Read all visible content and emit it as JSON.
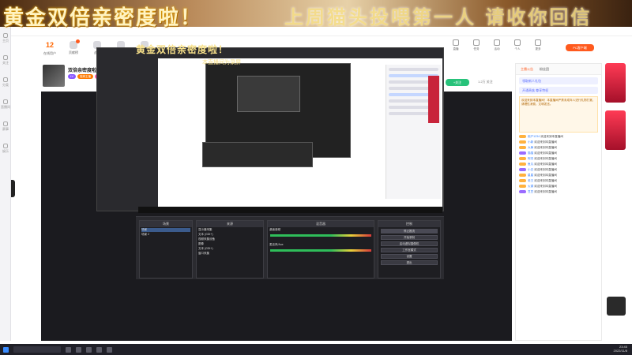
{
  "banner": {
    "left_text": "黄金双倍亲密度啦！",
    "right_text": "上周猫头投喂第一人  请收你回信"
  },
  "rail": {
    "items": [
      "主页",
      "关注",
      "分类",
      "直播间",
      "赛事",
      "娱乐"
    ]
  },
  "nav": {
    "count_value": "12",
    "items": [
      {
        "label": "在线用户",
        "icon": "users-icon",
        "num": true
      },
      {
        "label": "贡献榜",
        "icon": "trophy-icon",
        "dot": true
      },
      {
        "label": "战队",
        "icon": "team-icon"
      },
      {
        "label": "礼物",
        "icon": "gift-icon"
      },
      {
        "label": "分享",
        "icon": "share-icon"
      }
    ]
  },
  "room": {
    "title": "双倍亲密度啦！！！",
    "pills": [
      "LV",
      "猫窝主播",
      "黄金双倍",
      "亲密度"
    ]
  },
  "video": {
    "overlay_title": "黄金双倍亲密度啦！",
    "overlay_sub": "本直播间为录屏"
  },
  "obs": {
    "scenes_head": "场景",
    "sources_head": "来源",
    "mixer_head": "混音器",
    "controls_head": "控制",
    "scenes": [
      "场景",
      "场景 2"
    ],
    "sources": [
      "显示器采集",
      "文本 (GDI+)",
      "视频采集设备",
      "图像",
      "文本 (GDI+)",
      "窗口采集"
    ],
    "mixer_tracks": [
      "桌面音频",
      "麦克风/Aux"
    ],
    "controls": [
      "停止推流",
      "开始录制",
      "启动虚拟摄像机",
      "工作室模式",
      "设置",
      "退出"
    ]
  },
  "right": {
    "icons": [
      {
        "label": "直播",
        "icon": "live-icon"
      },
      {
        "label": "任务",
        "icon": "task-icon"
      },
      {
        "label": "活动",
        "icon": "event-icon"
      },
      {
        "label": "个人",
        "icon": "person-icon"
      },
      {
        "label": "更多",
        "icon": "more-icon"
      }
    ],
    "pc_button": "PC客户端",
    "follow_button": "+关注",
    "stats": "1.2万  关注"
  },
  "chat": {
    "tabs": [
      "主播公告",
      "粉丝团"
    ],
    "promo": [
      "领取新人礼包",
      "开通贵族 尊享特权"
    ],
    "notice": "欢迎来到本直播间！本直播间严禁未成年人进行礼物打赏，请理性消费，文明发言。",
    "messages": [
      {
        "name": "用户1234",
        "text": "欢迎来到本直播间"
      },
      {
        "name": "小新",
        "text": "欢迎来到本直播间"
      },
      {
        "name": "大黄",
        "text": "欢迎来到本直播间"
      },
      {
        "name": "猫猫",
        "text": "欢迎来到本直播间"
      },
      {
        "name": "阿杰",
        "text": "欢迎来到本直播间"
      },
      {
        "name": "鱼丸",
        "text": "欢迎来到本直播间"
      },
      {
        "name": "小白",
        "text": "欢迎来到本直播间"
      },
      {
        "name": "星星",
        "text": "欢迎来到本直播间"
      },
      {
        "name": "老王",
        "text": "欢迎来到本直播间"
      },
      {
        "name": "火锅",
        "text": "欢迎来到本直播间"
      },
      {
        "name": "豆豆",
        "text": "欢迎来到本直播间"
      }
    ]
  },
  "taskbar": {
    "time": "23:45",
    "date": "2022/11/8"
  },
  "colors": {
    "accent": "#ff5a1e",
    "banner_text": "#fff3c2",
    "video_bg": "#1b1b1f"
  }
}
